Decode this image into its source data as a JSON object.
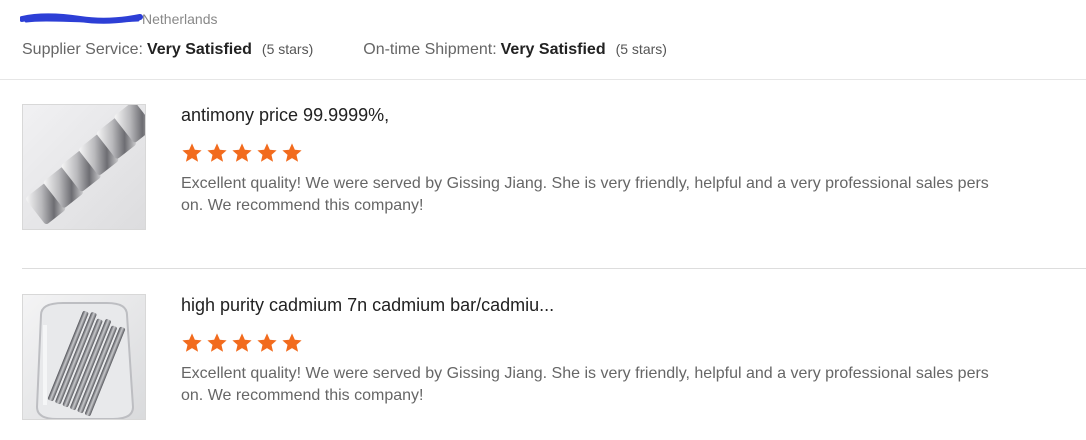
{
  "reviewer": {
    "name_redacted": true,
    "country": "Netherlands"
  },
  "ratings": {
    "supplier_service": {
      "label": "Supplier Service:",
      "value": "Very Satisfied",
      "note": "(5 stars)"
    },
    "on_time_shipment": {
      "label": "On-time Shipment:",
      "value": "Very Satisfied",
      "note": "(5 stars)"
    }
  },
  "colors": {
    "star": "#f26b1d",
    "divider": "#e6e6e6",
    "redaction": "#2d3fd6"
  },
  "reviews": [
    {
      "product_title": "antimony price 99.9999%,",
      "rating": 5,
      "text": "Excellent quality! We were served by Gissing Jiang. She is very friendly, helpful and a very professional sales person. We recommend this company!",
      "image_icon": "antimony-ingot-photo"
    },
    {
      "product_title": "high purity cadmium 7n cadmium bar/cadmiu...",
      "rating": 5,
      "text": "Excellent quality! We were served by Gissing Jiang. She is very friendly, helpful and a very professional sales person. We recommend this company!",
      "image_icon": "cadmium-bars-jar-photo"
    }
  ]
}
